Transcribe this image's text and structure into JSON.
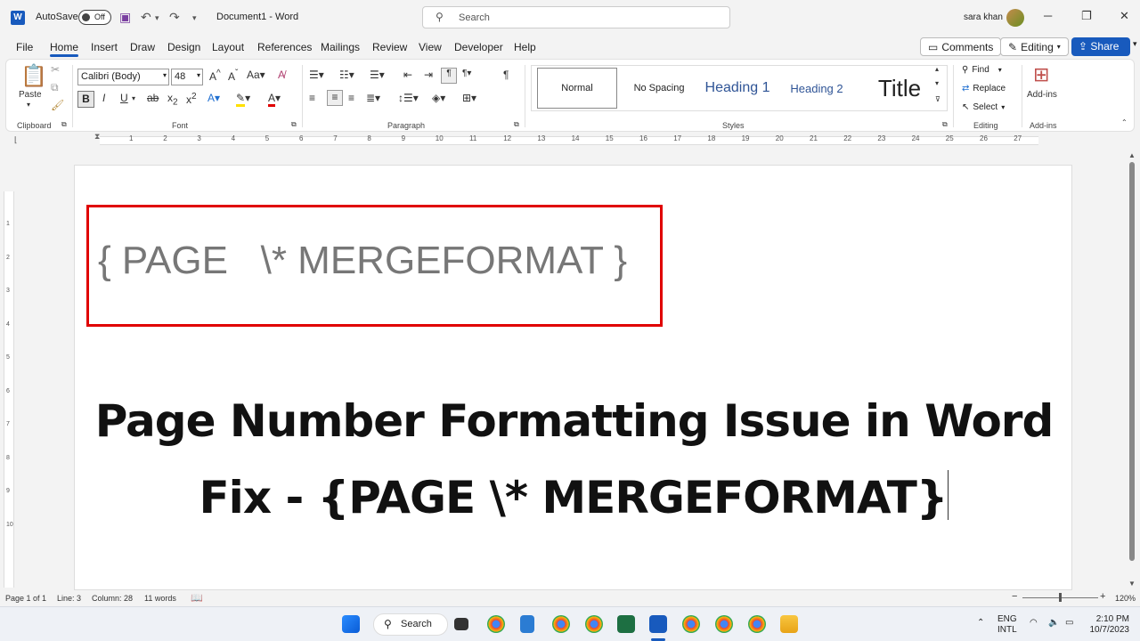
{
  "titlebar": {
    "app_icon": "W",
    "autosave_label": "AutoSave",
    "autosave_state": "Off",
    "doc_title": "Document1 - Word",
    "search_placeholder": "Search",
    "username": "sara khan"
  },
  "tabs": [
    "File",
    "Home",
    "Insert",
    "Draw",
    "Design",
    "Layout",
    "References",
    "Mailings",
    "Review",
    "View",
    "Developer",
    "Help"
  ],
  "active_tab": "Home",
  "top_right": {
    "comments": "Comments",
    "editing": "Editing",
    "share": "Share"
  },
  "ribbon": {
    "paste": "Paste",
    "font_name": "Calibri (Body)",
    "font_size": "48",
    "groups": {
      "clipboard": "Clipboard",
      "font": "Font",
      "paragraph": "Paragraph",
      "styles": "Styles",
      "editing": "Editing",
      "addins": "Add-ins"
    },
    "styles": [
      "Normal",
      "No Spacing",
      "Heading 1",
      "Heading 2",
      "Title"
    ],
    "editing": {
      "find": "Find",
      "replace": "Replace",
      "select": "Select"
    },
    "addins_label": "Add-ins"
  },
  "ruler_numbers": [
    "1",
    "2",
    "3",
    "4",
    "5",
    "6",
    "7",
    "8",
    "9",
    "10",
    "11",
    "12",
    "13",
    "14",
    "15",
    "16",
    "17",
    "18",
    "19",
    "20",
    "21",
    "22",
    "23",
    "24",
    "25",
    "26",
    "27"
  ],
  "vruler_numbers": [
    "1",
    "2",
    "3",
    "4",
    "5",
    "6",
    "7",
    "8",
    "9",
    "10"
  ],
  "document": {
    "field_code": "{ PAGE   \\* MERGEFORMAT }",
    "headline_line1": "Page Number Formatting Issue in Word",
    "headline_line2": "Fix - {PAGE \\* MERGEFORMAT}"
  },
  "status": {
    "page": "Page 1 of 1",
    "line": "Line: 3",
    "column": "Column: 28",
    "words": "11 words",
    "zoom": "120%"
  },
  "taskbar": {
    "search": "Search",
    "lang1": "ENG",
    "lang2": "INTL",
    "time": "2:10 PM",
    "date": "10/7/2023"
  },
  "colors": {
    "word_blue": "#185abd",
    "highlight_box": "#e00000",
    "field_gray": "#777777"
  }
}
